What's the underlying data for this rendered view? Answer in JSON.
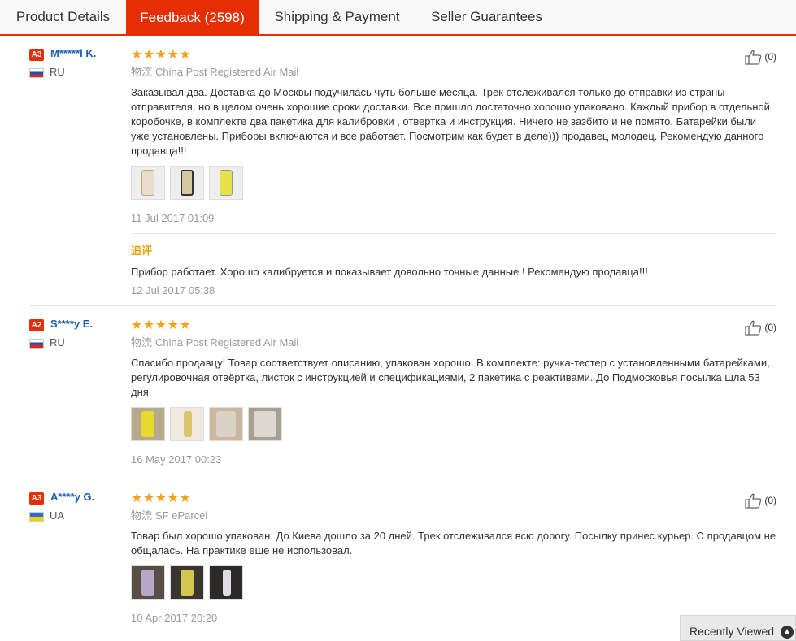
{
  "tabs": [
    {
      "label": "Product Details"
    },
    {
      "label": "Feedback (2598)"
    },
    {
      "label": "Shipping & Payment"
    },
    {
      "label": "Seller Guarantees"
    }
  ],
  "reviews": [
    {
      "badge": "A3",
      "name": "M*****l K.",
      "country": "RU",
      "stars": "★★★★★",
      "logistics_tag": "物流",
      "logistics": "China Post Registered Air Mail",
      "text": "Заказывал два. Доставка до Москвы подучилась чуть больше месяца. Трек отслеживался только до отправки из страны отправителя, но в целом очень хорошие сроки доставки. Все пришло достаточно хорошо упаковано. Каждый прибор в отдельной коробочке, в комплекте два пакетика для калибровки , отвертка и инструкция. Ничего не зазбито и не помято. Батарейки были уже установлены. Приборы включаются и все работает. Посмотрим как будет в деле))) продавец молодец. Рекомендую данного продавца!!!",
      "date": "11 Jul 2017 01:09",
      "likes": "(0)",
      "append_label": "追评",
      "append_text": "Прибор работает. Хорошо калибруется и показывает довольно точные данные ! Рекомендую продавца!!!",
      "append_date": "12 Jul 2017 05:38"
    },
    {
      "badge": "A2",
      "name": "S****y E.",
      "country": "RU",
      "stars": "★★★★★",
      "logistics_tag": "物流",
      "logistics": "China Post Registered Air Mail",
      "text": "Спасибо продавцу! Товар соответствует описанию, упакован хорошо. В комплекте: ручка-тестер с установленными батарейками, регулировочная отвёртка, листок с инструкцией и спецификациями, 2 пакетика с реактивами. До Подмосковья посылка шла 53 дня.",
      "date": "16 May 2017 00:23",
      "likes": "(0)"
    },
    {
      "badge": "A3",
      "name": "A****y G.",
      "country": "UA",
      "stars": "★★★★★",
      "logistics_tag": "物流",
      "logistics": "SF eParcel",
      "text": "Товар был хорошо упакован. До Киева дошло за 20 дней. Трек отслеживался всю дорогу. Посылку принес курьер. С продавцом не общалась. На практике еще не использовал.",
      "date": "10 Apr 2017 20:20",
      "likes": "(0)"
    }
  ],
  "recently_viewed": "Recently Viewed"
}
